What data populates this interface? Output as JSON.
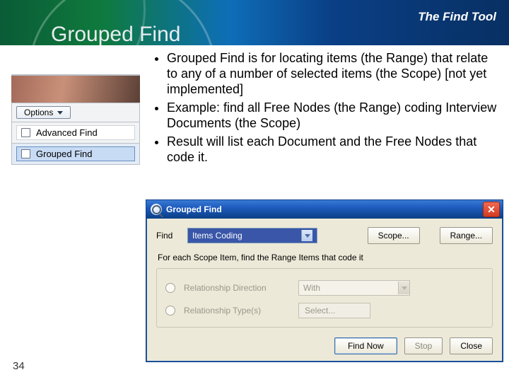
{
  "header": {
    "right": "The Find Tool",
    "title": "Grouped Find"
  },
  "bullets": [
    "Grouped Find is for locating items (the Range) that relate to any of a number of selected items (the Scope) [not yet implemented]",
    "Example: find all Free Nodes (the Range) coding Interview Documents (the Scope)",
    "Result will list each Document and the Free Nodes that code it."
  ],
  "page_number": "34",
  "menu_snip": {
    "options_btn": "Options",
    "item_advanced": "Advanced Find",
    "item_grouped": "Grouped Find"
  },
  "dialog": {
    "title": "Grouped Find",
    "find_label": "Find",
    "find_value": "Items Coding",
    "scope_btn": "Scope...",
    "range_btn": "Range...",
    "description": "For each Scope Item, find the Range Items that code it",
    "radio_direction": "Relationship Direction",
    "direction_value": "With",
    "radio_types": "Relationship Type(s)",
    "select_btn": "Select...",
    "find_now": "Find Now",
    "stop": "Stop",
    "close": "Close"
  }
}
